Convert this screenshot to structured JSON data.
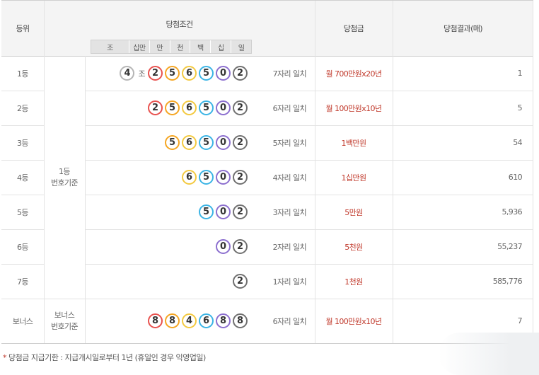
{
  "header": {
    "rank": "등위",
    "condition": "당첨조건",
    "prize": "당첨금",
    "result": "당첨결과(매)",
    "places": [
      "조",
      "십만",
      "만",
      "천",
      "백",
      "십",
      "일"
    ]
  },
  "group_label": {
    "line1": "1등",
    "line2": "번호기준"
  },
  "bonus_group_label": {
    "line1": "보너스",
    "line2": "번호기준"
  },
  "jo_suffix": "조",
  "rows": [
    {
      "rank": "1등",
      "balls": [
        "2",
        "5",
        "6",
        "5",
        "0",
        "2"
      ],
      "jo": "4",
      "match": "7자리 일치",
      "prize": "월 700만원x20년",
      "count": "1"
    },
    {
      "rank": "2등",
      "balls": [
        "2",
        "5",
        "6",
        "5",
        "0",
        "2"
      ],
      "match": "6자리 일치",
      "prize": "월 100만원x10년",
      "count": "5"
    },
    {
      "rank": "3등",
      "balls": [
        "5",
        "6",
        "5",
        "0",
        "2"
      ],
      "match": "5자리 일치",
      "prize": "1백만원",
      "count": "54"
    },
    {
      "rank": "4등",
      "balls": [
        "6",
        "5",
        "0",
        "2"
      ],
      "match": "4자리 일치",
      "prize": "1십만원",
      "count": "610"
    },
    {
      "rank": "5등",
      "balls": [
        "5",
        "0",
        "2"
      ],
      "match": "3자리 일치",
      "prize": "5만원",
      "count": "5,936"
    },
    {
      "rank": "6등",
      "balls": [
        "0",
        "2"
      ],
      "match": "2자리 일치",
      "prize": "5천원",
      "count": "55,237"
    },
    {
      "rank": "7등",
      "balls": [
        "2"
      ],
      "match": "1자리 일치",
      "prize": "1천원",
      "count": "585,776"
    },
    {
      "rank": "보너스",
      "balls": [
        "8",
        "8",
        "4",
        "6",
        "8",
        "8"
      ],
      "match": "6자리 일치",
      "prize": "월 100만원x10년",
      "count": "7"
    }
  ],
  "colors": {
    "jo": "#b5b5b5",
    "d2": "#e8524f",
    "d5": "#f5a623",
    "d6": "#f3c940",
    "d5b": "#3bb4e5",
    "d0": "#8c6fcf",
    "d2b": "#707070",
    "d8": "#e8524f",
    "d4": "#f5a623",
    "d6b": "#3bb4e5",
    "d8b": "#8c6fcf",
    "d8c": "#707070"
  },
  "footnote": "당첨금 지급기한 : 지급개시일로부터 1년 (휴일인 경우 익영업일)",
  "footnote_marker": "*"
}
